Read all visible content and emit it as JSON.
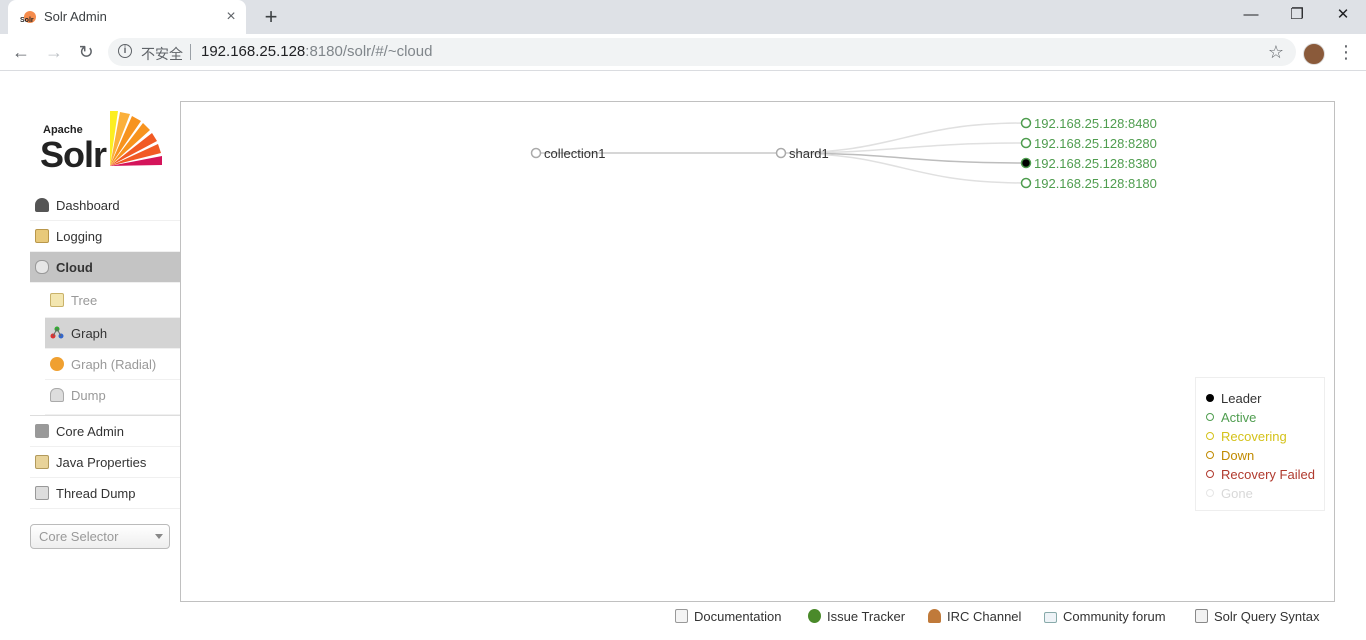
{
  "browser": {
    "tab_title": "Solr Admin",
    "new_tab_label": "+",
    "close_tab_label": "×",
    "security_label": "不安全",
    "url_host": "192.168.25.128",
    "url_rest": ":8180/solr/#/~cloud",
    "window_controls": {
      "minimize": "—",
      "restore": "❐",
      "close": "✕"
    },
    "nav": {
      "back": "←",
      "forward": "→",
      "reload": "↻",
      "star": "☆",
      "menu": "⋮"
    }
  },
  "logo": {
    "apache": "Apache",
    "solr": "Solr",
    "favicon_text": "Solr"
  },
  "menu": {
    "items": [
      {
        "label": "Dashboard",
        "icon": "dashboard-icon"
      },
      {
        "label": "Logging",
        "icon": "logging-icon"
      },
      {
        "label": "Cloud",
        "icon": "cloud-icon",
        "active": true
      }
    ],
    "cloud_sub": [
      {
        "label": "Tree",
        "icon": "tree-icon"
      },
      {
        "label": "Graph",
        "icon": "graph-icon",
        "active": true
      },
      {
        "label": "Graph (Radial)",
        "icon": "graph-radial-icon"
      },
      {
        "label": "Dump",
        "icon": "dump-icon"
      }
    ],
    "items2": [
      {
        "label": "Core Admin",
        "icon": "core-admin-icon"
      },
      {
        "label": "Java Properties",
        "icon": "java-properties-icon"
      },
      {
        "label": "Thread Dump",
        "icon": "thread-dump-icon"
      }
    ],
    "core_selector": "Core Selector"
  },
  "graph": {
    "collection": "collection1",
    "shard": "shard1",
    "replicas": [
      {
        "label": "192.168.25.128:8480",
        "state": "active"
      },
      {
        "label": "192.168.25.128:8280",
        "state": "active"
      },
      {
        "label": "192.168.25.128:8380",
        "state": "leader"
      },
      {
        "label": "192.168.25.128:8180",
        "state": "active"
      }
    ]
  },
  "legend": [
    {
      "label": "Leader",
      "color": "#000000",
      "filled": true
    },
    {
      "label": "Active",
      "color": "#4f9d4f"
    },
    {
      "label": "Recovering",
      "color": "#d4c21a"
    },
    {
      "label": "Down",
      "color": "#c08a00"
    },
    {
      "label": "Recovery Failed",
      "color": "#b03a2e"
    },
    {
      "label": "Gone",
      "color": "#d8d8d8"
    }
  ],
  "footer": [
    {
      "label": "Documentation",
      "icon": "document-icon"
    },
    {
      "label": "Issue Tracker",
      "icon": "bug-icon"
    },
    {
      "label": "IRC Channel",
      "icon": "irc-icon"
    },
    {
      "label": "Community forum",
      "icon": "mail-icon"
    },
    {
      "label": "Solr Query Syntax",
      "icon": "query-syntax-icon"
    }
  ]
}
